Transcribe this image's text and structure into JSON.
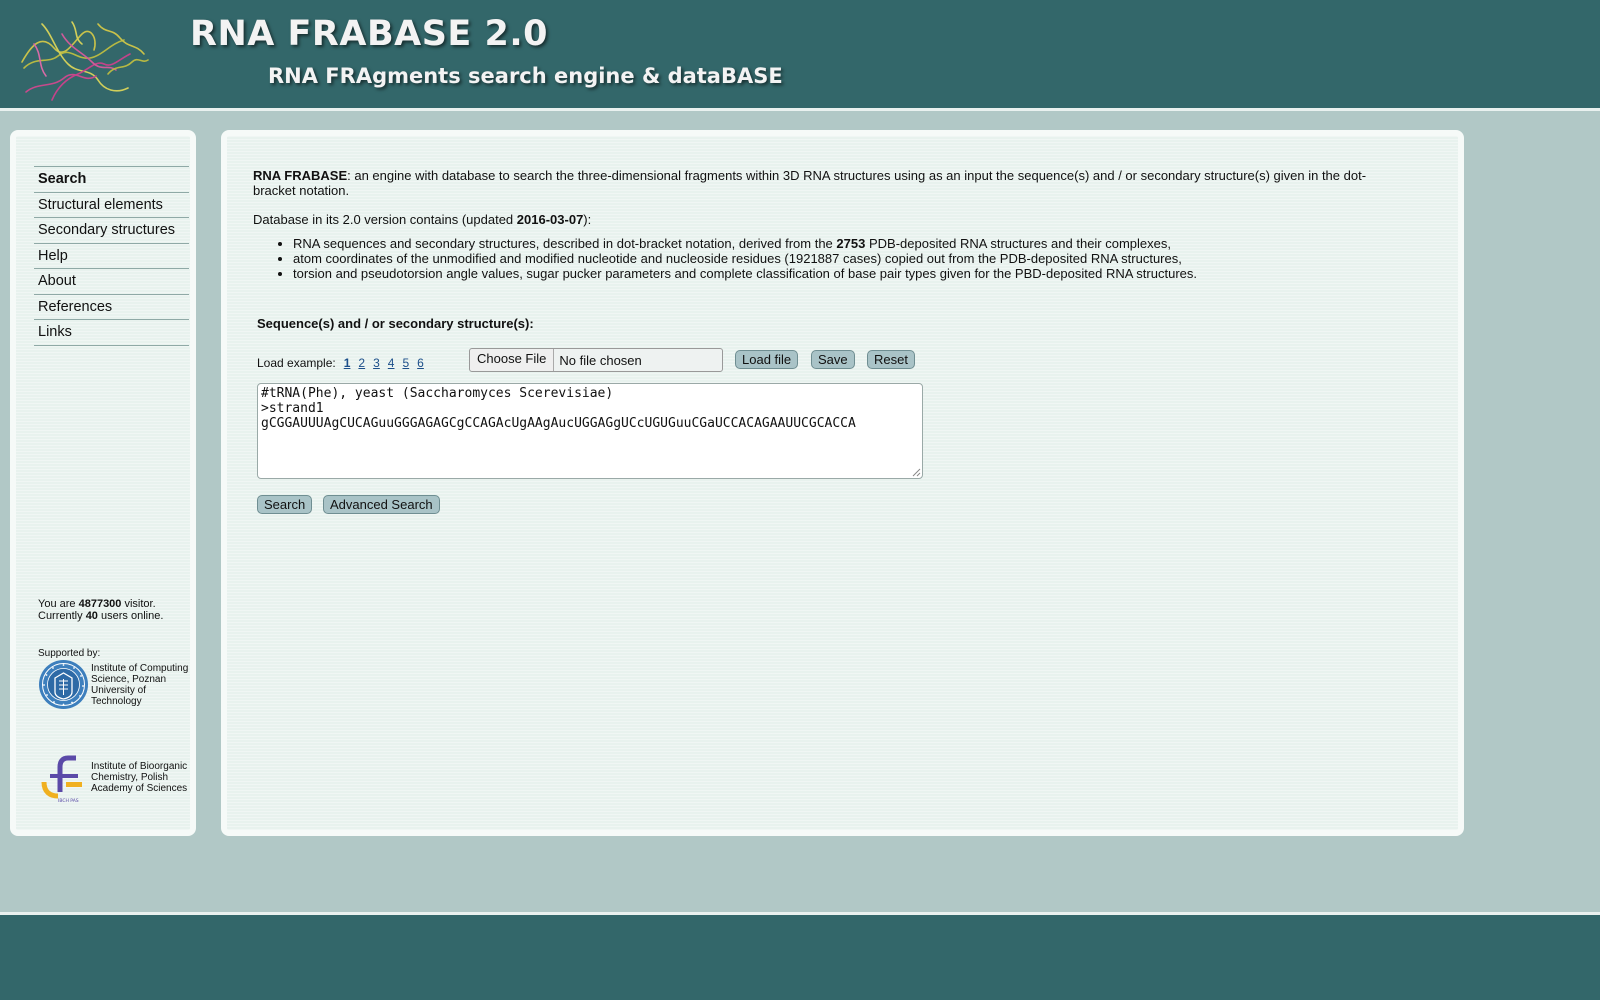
{
  "header": {
    "title": "RNA FRABASE 2.0",
    "subtitle": "RNA FRAgments search engine & dataBASE",
    "logo_icon": "rna-structure-logo-icon"
  },
  "nav": {
    "items": [
      {
        "label": "Search",
        "active": true
      },
      {
        "label": "Structural elements"
      },
      {
        "label": "Secondary structures"
      },
      {
        "label": "Help"
      },
      {
        "label": "About"
      },
      {
        "label": "References"
      },
      {
        "label": "Links"
      }
    ]
  },
  "stats": {
    "visitor_prefix": "You are",
    "visitor_count": "4877300",
    "visitor_suffix": "visitor.",
    "online_prefix": "Currently",
    "online_count": "40",
    "online_suffix": "users online."
  },
  "supporters": {
    "label": "Supported by:",
    "items": [
      {
        "name": "Institute of Computing Science, Poznan University of Technology",
        "icon": "put-university-seal-icon"
      },
      {
        "name": "Institute of Bioorganic Chemistry, Polish Academy of Sciences",
        "icon": "ibch-pas-logo-icon"
      }
    ]
  },
  "intro": {
    "name": "RNA FRABASE",
    "text": ": an engine with database to search the three-dimensional fragments within 3D RNA structures using as an input the sequence(s) and / or secondary structure(s) given in the dot-bracket notation."
  },
  "database": {
    "prefix": "Database in its 2.0 version contains (updated",
    "date": "2016-03-07",
    "suffix": "):",
    "facts": {
      "f1_prefix": "RNA sequences and secondary structures, described in dot-bracket notation, derived from the",
      "f1_count": "2753",
      "f1_suffix": "PDB-deposited RNA structures and their complexes,",
      "f2": "atom coordinates of the unmodified and modified nucleotide and nucleoside residues (1921887 cases) copied out from the PDB-deposited RNA structures,",
      "f3": "torsion and pseudotorsion angle values, sugar pucker parameters and complete classification of base pair types given for the PBD-deposited RNA structures."
    }
  },
  "form": {
    "label": "Sequence(s) and / or secondary structure(s):",
    "examples_label": "Load example:",
    "examples": [
      "1",
      "2",
      "3",
      "4",
      "5",
      "6"
    ],
    "active_example": "1",
    "choose_file": "Choose File",
    "no_file": "No file chosen",
    "load_file": "Load file",
    "save": "Save",
    "reset": "Reset",
    "sequence_value": "#tRNA(Phe), yeast (Saccharomyces Scerevisiae)\n>strand1\ngCGGAUUUAgCUCAGuuGGGAGAGCgCCAGAcUgAAgAucUGGAGgUCcUGUGuuCGaUCCACAGAAUUCGCACCA",
    "search": "Search",
    "advanced_search": "Advanced Search"
  },
  "colors": {
    "header_bg": "#33676a",
    "page_bg": "#b1c8c6",
    "panel_bg": "#e8f2ee",
    "button_bg": "#a9c3c7",
    "link": "#1c4f8a"
  }
}
